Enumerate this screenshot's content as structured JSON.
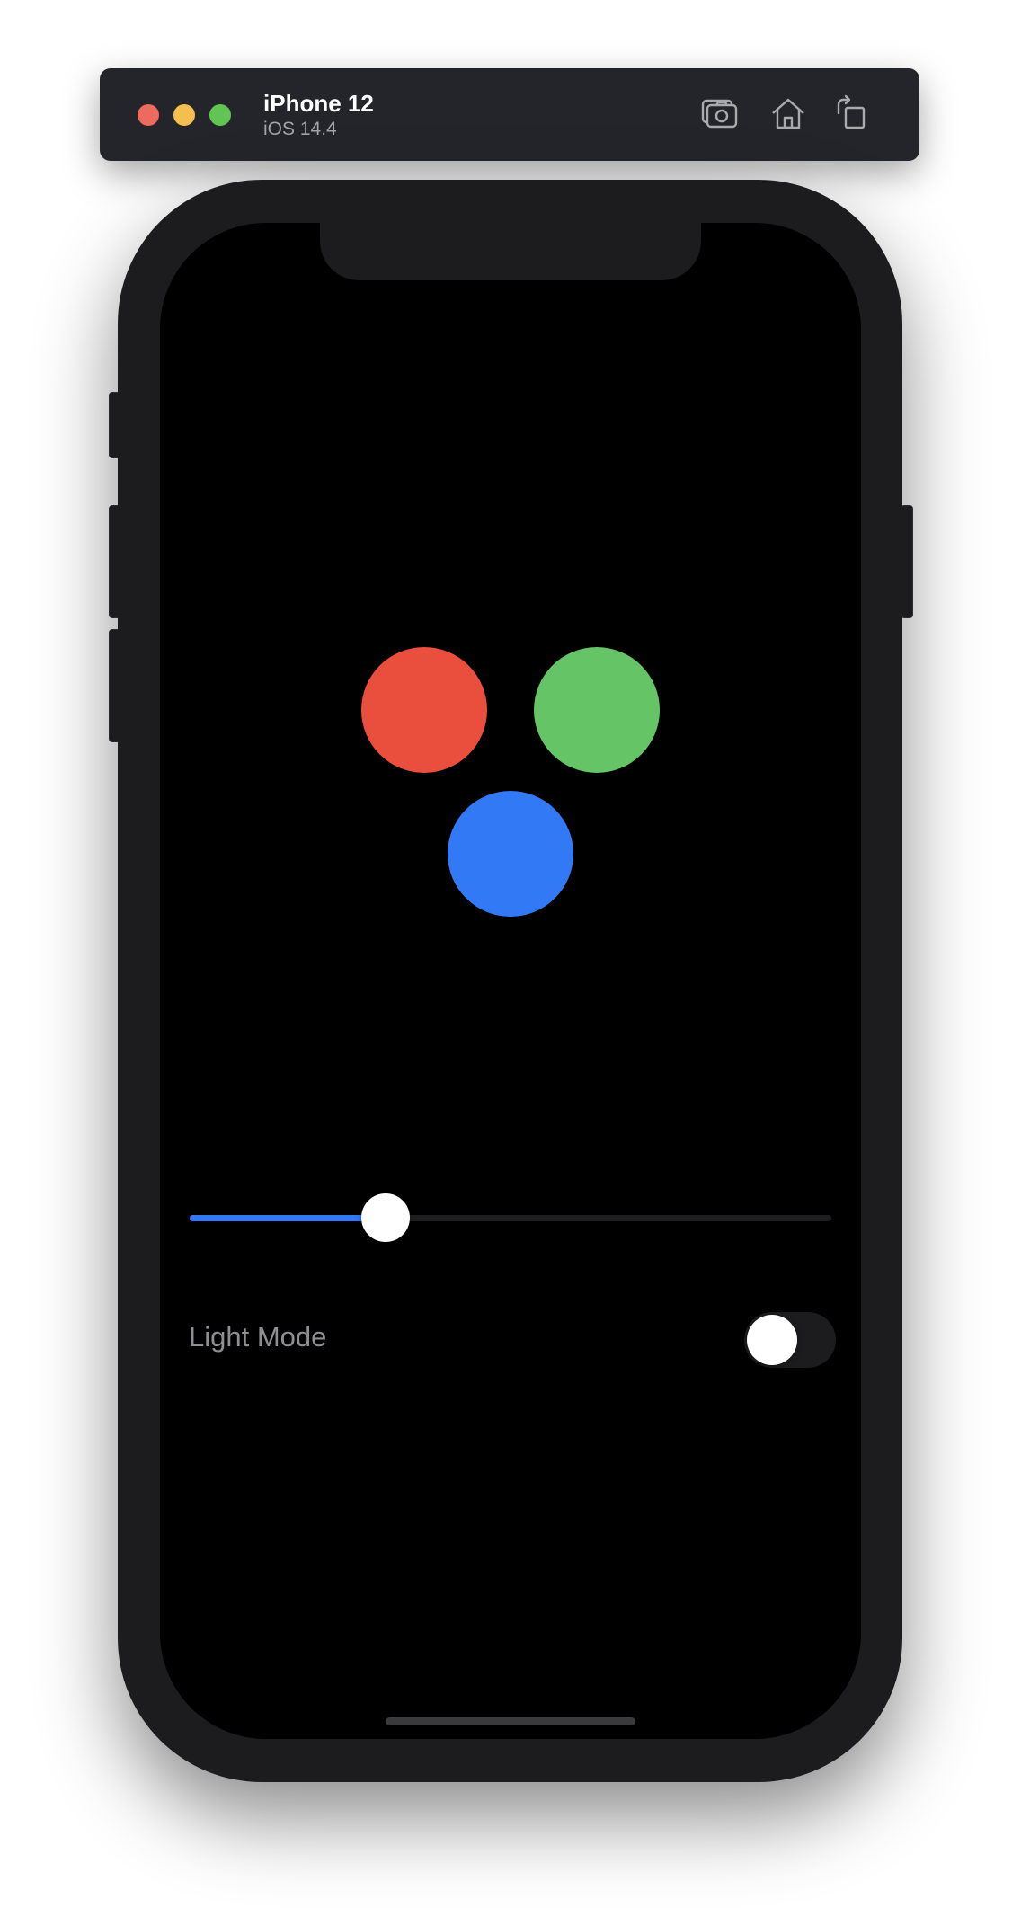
{
  "titlebar": {
    "device_name": "iPhone 12",
    "os_version": "iOS 14.4",
    "window_controls": [
      {
        "name": "close",
        "color": "#ec6a5e"
      },
      {
        "name": "minimize",
        "color": "#f4bf4f"
      },
      {
        "name": "zoom",
        "color": "#61c554"
      }
    ],
    "toolbar_icons": [
      "screenshot-icon",
      "home-icon",
      "rotate-icon"
    ]
  },
  "screen": {
    "background_color": "#000000",
    "circles": [
      {
        "name": "red",
        "color": "#ea4e3d"
      },
      {
        "name": "green",
        "color": "#65c466"
      },
      {
        "name": "blue",
        "color": "#3279f5"
      }
    ],
    "slider": {
      "value": 0.305,
      "fill_color": "#3478f6",
      "track_color": "#1f1f21"
    },
    "light_mode": {
      "label": "Light Mode",
      "on": false
    }
  }
}
